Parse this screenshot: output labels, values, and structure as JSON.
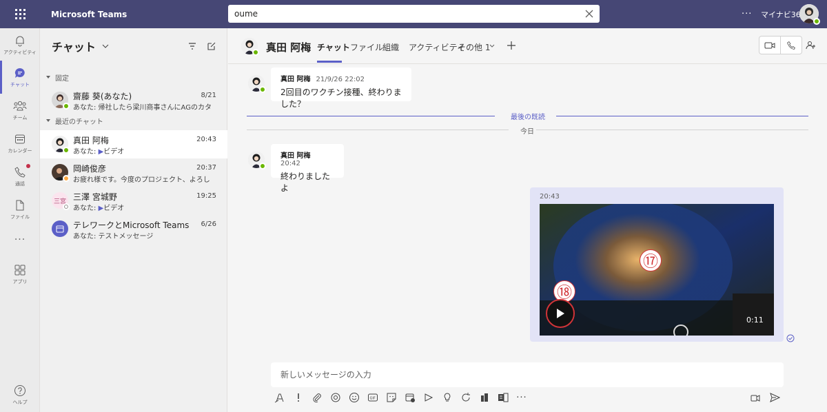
{
  "topbar": {
    "app_title": "Microsoft Teams",
    "search_value": "oume",
    "more_label": "···",
    "org_name": "マイナビ365"
  },
  "rail": {
    "items": [
      {
        "label": "アクティビティ",
        "icon": "bell-icon"
      },
      {
        "label": "チャット",
        "icon": "chat-icon"
      },
      {
        "label": "チーム",
        "icon": "teams-icon"
      },
      {
        "label": "カレンダー",
        "icon": "calendar-icon"
      },
      {
        "label": "通話",
        "icon": "phone-icon"
      },
      {
        "label": "ファイル",
        "icon": "file-icon"
      },
      {
        "label": "アプリ",
        "icon": "apps-icon"
      },
      {
        "label": "ヘルプ",
        "icon": "help-icon"
      }
    ],
    "more": "···"
  },
  "chatlist": {
    "title": "チャット",
    "pinned_header": "固定",
    "recent_header": "最近のチャット",
    "items": [
      {
        "name": "齋藤 葵(あなた)",
        "preview": "あなた: 帰社したら梁川商事さんにAGのカタロ...",
        "time": "8/21"
      },
      {
        "name": "真田 阿梅",
        "preview_prefix": "あなた:",
        "preview": "ビデオ",
        "time": "20:43"
      },
      {
        "name": "岡崎俊彦",
        "preview": "お疲れ様です。今度のプロジェクト、よろしくお...",
        "time": "20:37"
      },
      {
        "name": "三澤 宮城野",
        "preview_prefix": "あなた:",
        "preview": "ビデオ",
        "time": "19:25",
        "initials": "三宮"
      },
      {
        "name": "テレワークとMicrosoft Teams",
        "preview": "あなた: テストメッセージ",
        "time": "6/26"
      }
    ]
  },
  "conversation": {
    "name": "真田 阿梅",
    "tabs": [
      "チャット",
      "ファイル",
      "組織",
      "アクティビティ",
      "その他 1"
    ],
    "messages": [
      {
        "sender": "真田 阿梅",
        "time": "21/9/26 22:02",
        "text": "2回目のワクチン接種、終わりました？"
      },
      {
        "sender": "真田 阿梅",
        "time": "20:42",
        "text": "終わりましたよ"
      }
    ],
    "last_read_label": "最後の既読",
    "today_label": "今日",
    "my_message": {
      "time": "20:43",
      "video_duration": "0:11"
    },
    "annotations": [
      "⑰",
      "⑱"
    ],
    "compose_placeholder": "新しいメッセージの入力"
  },
  "colors": {
    "topbar": "#464775",
    "accent": "#5b5fc7",
    "presence_available": "#6bb700",
    "presence_away": "#ffaa44",
    "annotation_red": "#d13438"
  }
}
